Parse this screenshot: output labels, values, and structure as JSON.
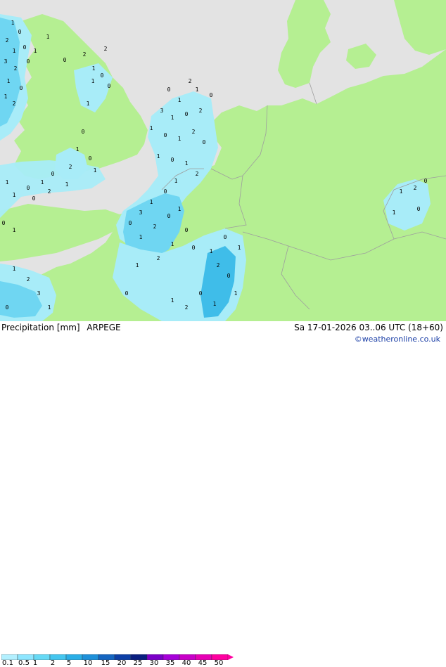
{
  "header": {
    "title": "Precipitation [mm]",
    "model": "ARPEGE",
    "valid_time": "Sa 17-01-2026 03..06 UTC (18+60)",
    "copyright": "©weatheronline.co.uk"
  },
  "legend": {
    "ticks": [
      "0.1",
      "0.5",
      "1",
      "2",
      "5",
      "10",
      "15",
      "20",
      "25",
      "30",
      "35",
      "40",
      "45",
      "50"
    ],
    "colors": [
      "#b3f0ff",
      "#8ee6ff",
      "#66d9f5",
      "#45c6ef",
      "#2aaee6",
      "#1e90d9",
      "#1565c0",
      "#0d3fa6",
      "#0a1f80",
      "#7b00c8",
      "#a600d9",
      "#c800c8",
      "#e600b4",
      "#ff00a0"
    ]
  },
  "map": {
    "colors": {
      "sea": "#e3e3e3",
      "land": "#b5ef92",
      "precip_light": "#a8ecf8",
      "precip_medium": "#6fd6f2",
      "precip_heavy": "#3fbde9",
      "border": "#9e9e9e"
    },
    "markers": [
      {
        "v": "1"
      },
      {
        "v": "0"
      },
      {
        "v": "2"
      },
      {
        "v": "1"
      },
      {
        "v": "0"
      },
      {
        "v": "3"
      },
      {
        "v": "2"
      },
      {
        "v": "1"
      },
      {
        "v": "0"
      },
      {
        "v": "1"
      },
      {
        "v": "2"
      },
      {
        "v": "0"
      },
      {
        "v": "1"
      },
      {
        "v": "1"
      },
      {
        "v": "0"
      },
      {
        "v": "2"
      },
      {
        "v": "1"
      },
      {
        "v": "0"
      },
      {
        "v": "1"
      },
      {
        "v": "0"
      },
      {
        "v": "1"
      },
      {
        "v": "2"
      },
      {
        "v": "0"
      },
      {
        "v": "1"
      },
      {
        "v": "0"
      },
      {
        "v": "1"
      },
      {
        "v": "2"
      },
      {
        "v": "0"
      },
      {
        "v": "1"
      },
      {
        "v": "0"
      },
      {
        "v": "1"
      },
      {
        "v": "1"
      },
      {
        "v": "0"
      },
      {
        "v": "2"
      },
      {
        "v": "1"
      },
      {
        "v": "0"
      },
      {
        "v": "1"
      },
      {
        "v": "0"
      },
      {
        "v": "1"
      },
      {
        "v": "2"
      },
      {
        "v": "1"
      },
      {
        "v": "0"
      },
      {
        "v": "3"
      },
      {
        "v": "1"
      },
      {
        "v": "0"
      },
      {
        "v": "2"
      },
      {
        "v": "1"
      },
      {
        "v": "0"
      },
      {
        "v": "1"
      },
      {
        "v": "2"
      },
      {
        "v": "0"
      },
      {
        "v": "1"
      },
      {
        "v": "0"
      },
      {
        "v": "1"
      },
      {
        "v": "2"
      },
      {
        "v": "1"
      },
      {
        "v": "0"
      },
      {
        "v": "1"
      },
      {
        "v": "3"
      },
      {
        "v": "0"
      },
      {
        "v": "1"
      },
      {
        "v": "2"
      },
      {
        "v": "0"
      },
      {
        "v": "1"
      },
      {
        "v": "0"
      },
      {
        "v": "1"
      },
      {
        "v": "2"
      },
      {
        "v": "1"
      },
      {
        "v": "0"
      },
      {
        "v": "1"
      },
      {
        "v": "0"
      },
      {
        "v": "1"
      },
      {
        "v": "2"
      },
      {
        "v": "0"
      },
      {
        "v": "1"
      },
      {
        "v": "1"
      },
      {
        "v": "0"
      },
      {
        "v": "2"
      },
      {
        "v": "1"
      },
      {
        "v": "0"
      },
      {
        "v": "1"
      },
      {
        "v": "2"
      },
      {
        "v": "3"
      },
      {
        "v": "1"
      },
      {
        "v": "0"
      },
      {
        "v": "1"
      },
      {
        "v": "2"
      },
      {
        "v": "0"
      },
      {
        "v": "1"
      },
      {
        "v": "0"
      }
    ]
  }
}
